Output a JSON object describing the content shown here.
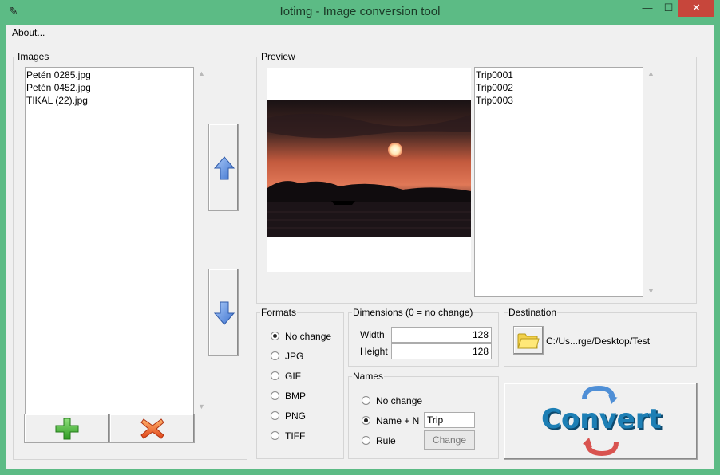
{
  "window": {
    "title": "Iotimg - Image conversion tool",
    "minimize_glyph": "—",
    "maximize_glyph": "☐",
    "close_glyph": "✕"
  },
  "menu": {
    "about": "About..."
  },
  "images": {
    "legend": "Images",
    "files": [
      "Petén 0285.jpg",
      "Petén 0452.jpg",
      "TIKAL (22).jpg"
    ]
  },
  "preview": {
    "legend": "Preview",
    "names": [
      "Trip0001",
      "Trip0002",
      "Trip0003"
    ]
  },
  "formats": {
    "legend": "Formats",
    "options": [
      "No change",
      "JPG",
      "GIF",
      "BMP",
      "PNG",
      "TIFF"
    ],
    "selected": "No change"
  },
  "dimensions": {
    "legend": "Dimensions (0 = no change)",
    "width_label": "Width",
    "width_value": "128",
    "height_label": "Height",
    "height_value": "128"
  },
  "names": {
    "legend": "Names",
    "options": [
      "No change",
      "Name + N",
      "Rule"
    ],
    "selected": "Name + N",
    "prefix_value": "Trip",
    "change_label": "Change"
  },
  "destination": {
    "legend": "Destination",
    "path": "C:/Us...rge/Desktop/Test"
  },
  "convert": {
    "label": "Convert"
  },
  "colors": {
    "titlebar": "#5cbb85",
    "close": "#c7463b",
    "arrow_blue": "#5b8fe0",
    "add_green": "#3fae2f",
    "remove_orange": "#e86a1f",
    "convert_text": "#1d7fb5",
    "convert_arrow_red": "#d9534f"
  },
  "icons": {
    "move_up": "arrow-up-icon",
    "move_down": "arrow-down-icon",
    "add": "plus-icon",
    "remove": "x-icon",
    "folder": "folder-icon"
  }
}
